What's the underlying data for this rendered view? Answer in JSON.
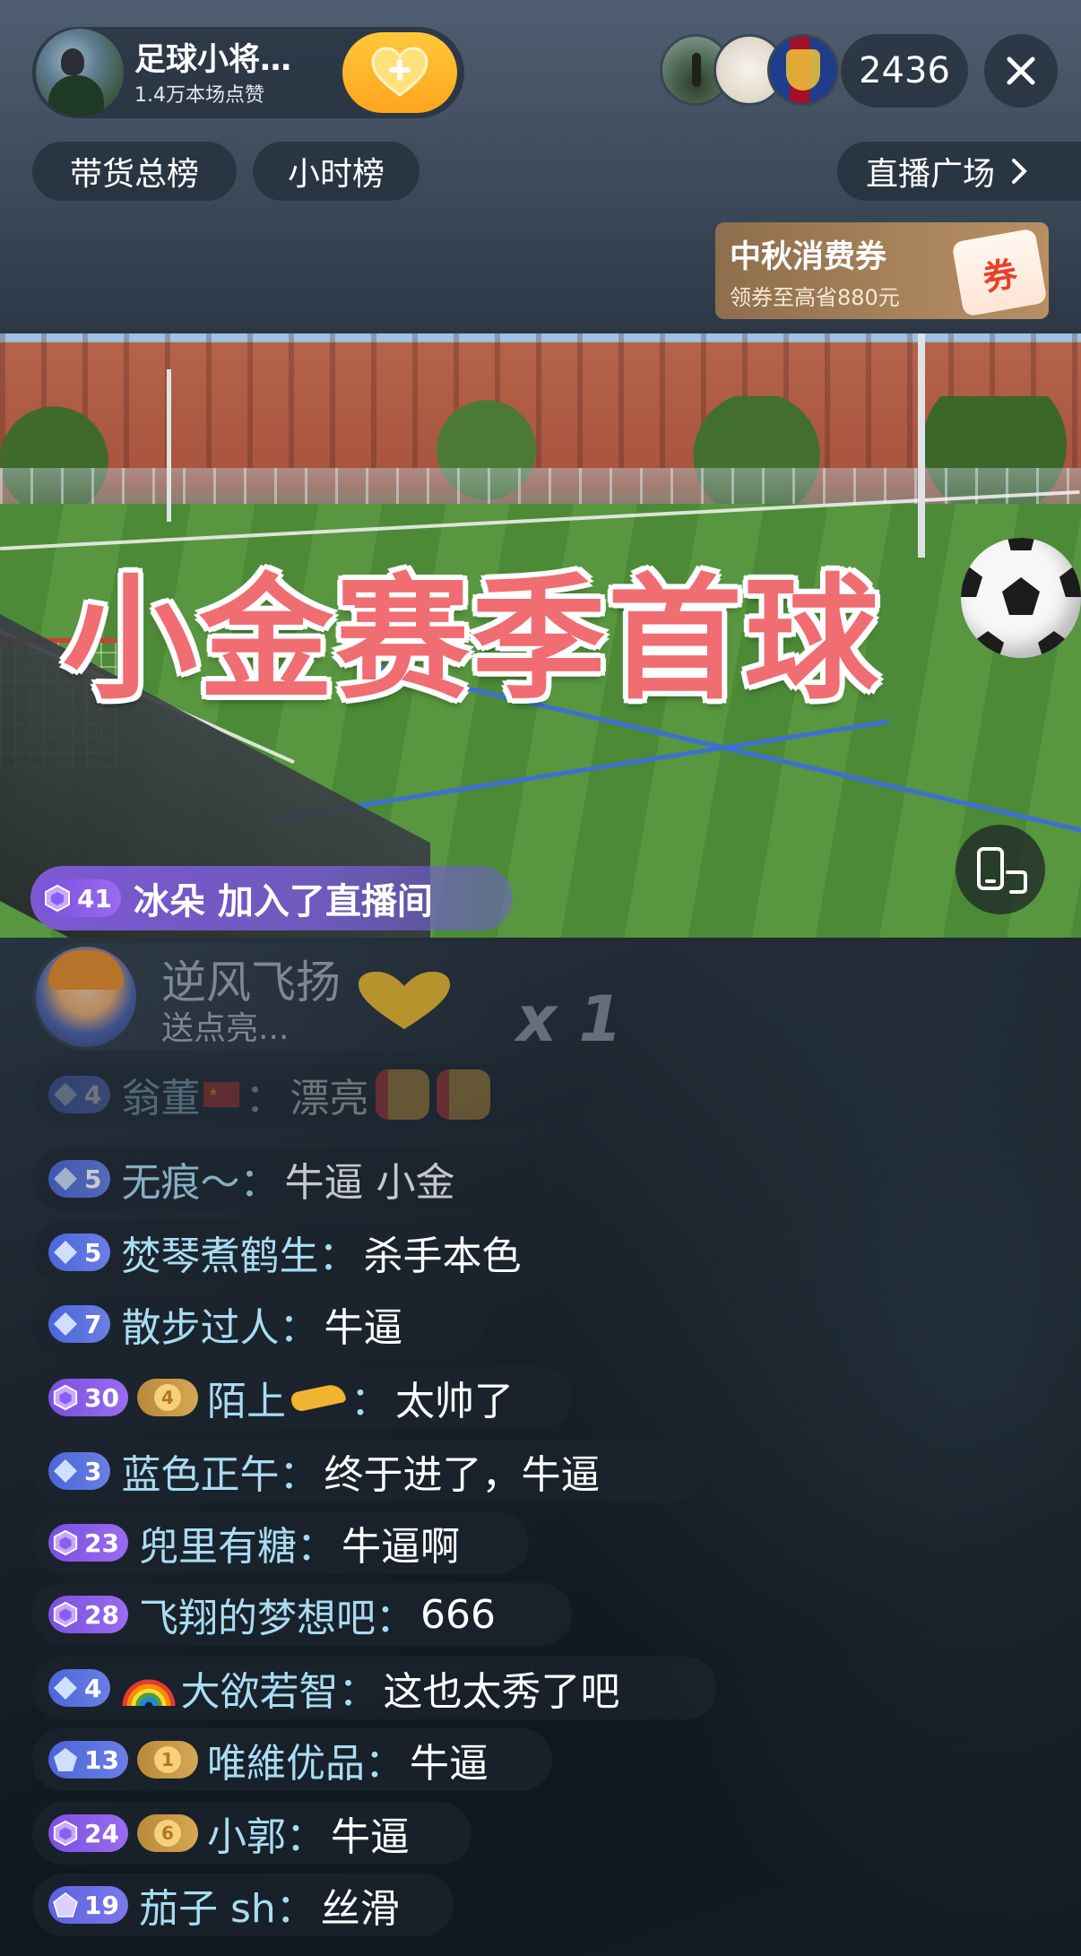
{
  "host": {
    "name": "足球小将…",
    "likes": "1.4万本场点赞"
  },
  "top": {
    "viewer_count": "2436"
  },
  "ranks": {
    "total": "带货总榜",
    "hourly": "小时榜"
  },
  "plaza": {
    "label": "直播广场"
  },
  "coupon": {
    "title": "中秋消费券",
    "subtitle": "领券至高省880元",
    "tag": "券"
  },
  "video": {
    "overlay_title": "小金赛季首球",
    "ball_emoji": "football-icon"
  },
  "join_banner": {
    "level": "41",
    "text": "冰朵 加入了直播间"
  },
  "gift": {
    "user": "逆风飞扬",
    "sub": "送点亮...",
    "count": "x 1"
  },
  "chat": [
    {
      "level": "4",
      "level_style": "blue",
      "fan": "",
      "name": "翁董",
      "msg": "漂亮"
    },
    {
      "level": "5",
      "level_style": "blue",
      "fan": "",
      "name": "无痕～：",
      "msg": "牛逼  小金"
    },
    {
      "level": "5",
      "level_style": "blue",
      "fan": "",
      "name": "焚琴煮鹤生：",
      "msg": "杀手本色"
    },
    {
      "level": "7",
      "level_style": "blue",
      "fan": "",
      "name": "散步过人：",
      "msg": "牛逼"
    },
    {
      "level": "30",
      "level_style": "purple",
      "fan": "4",
      "name": "陌上",
      "msg": "太帅了"
    },
    {
      "level": "3",
      "level_style": "blue",
      "fan": "",
      "name": "蓝色正午：",
      "msg": "终于进了，牛逼"
    },
    {
      "level": "23",
      "level_style": "purple",
      "fan": "",
      "name": "兜里有糖：",
      "msg": "牛逼啊"
    },
    {
      "level": "28",
      "level_style": "purple",
      "fan": "",
      "name": "飞翔的梦想吧：",
      "msg": "666"
    },
    {
      "level": "4",
      "level_style": "blue",
      "fan": "",
      "name": "大欲若智：",
      "msg": "这也太秀了吧"
    },
    {
      "level": "13",
      "level_style": "blue",
      "fan": "1",
      "name": "唯維优品：",
      "msg": "牛逼"
    },
    {
      "level": "24",
      "level_style": "purple",
      "fan": "6",
      "name": "小郭：",
      "msg": "牛逼"
    },
    {
      "level": "19",
      "level_style": "blue",
      "fan": "",
      "name": "茄子 sh：",
      "msg": "丝滑"
    }
  ]
}
